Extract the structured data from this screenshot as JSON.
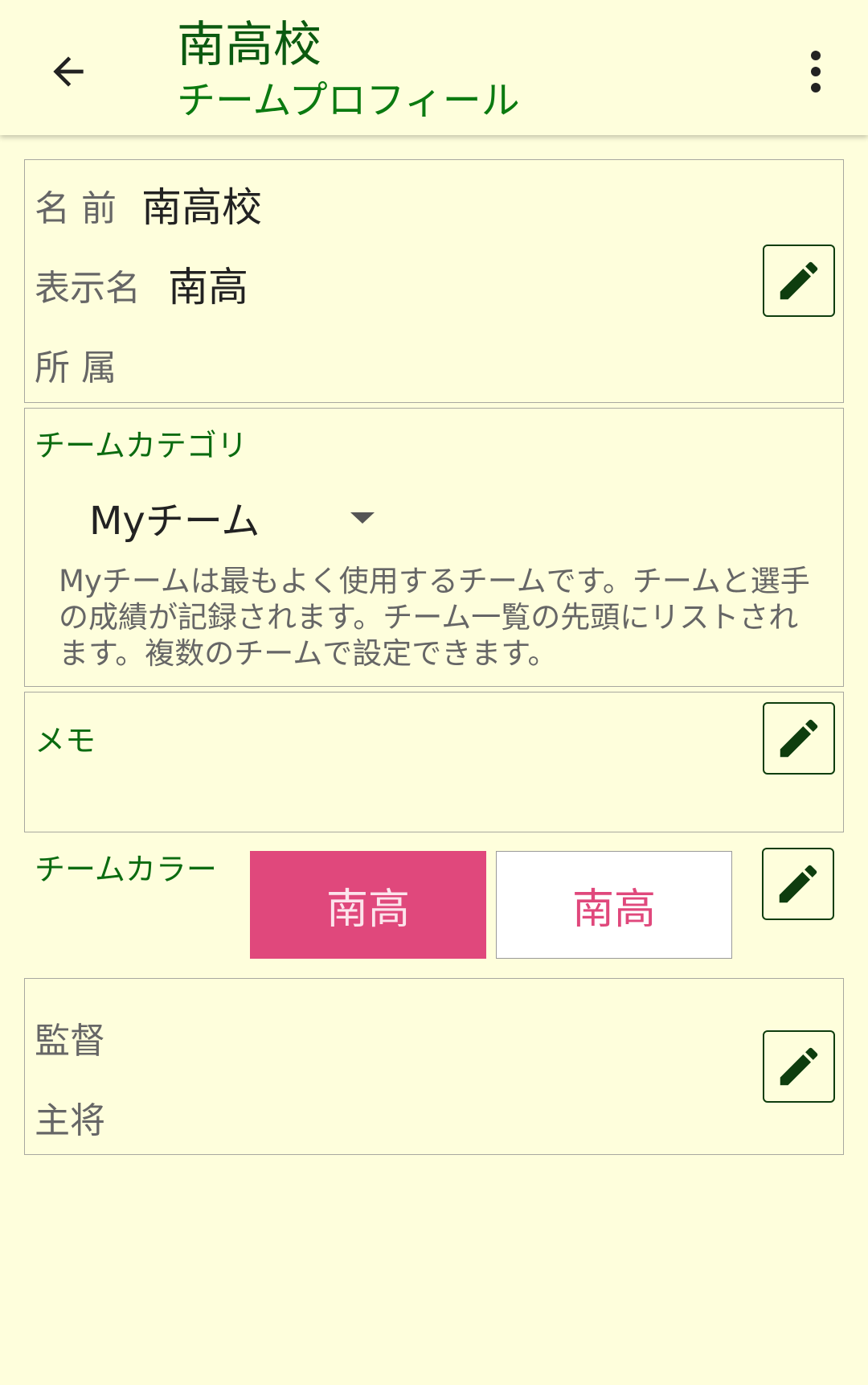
{
  "header": {
    "title": "南高校",
    "subtitle": "チームプロフィール",
    "back_icon": "arrow-left-icon",
    "menu_icon": "more-vert-icon"
  },
  "profile": {
    "name_label": "名 前",
    "name_value": "南高校",
    "display_name_label": "表示名",
    "display_name_value": "南高",
    "affiliation_label": "所 属",
    "affiliation_value": ""
  },
  "category": {
    "label": "チームカテゴリ",
    "selected": "Myチーム",
    "description": "Myチームは最もよく使用するチームです。チームと選手の成績が記録されます。チーム一覧の先頭にリストされます。複数のチームで設定できます。"
  },
  "memo": {
    "label": "メモ",
    "value": ""
  },
  "team_color": {
    "label": "チームカラー",
    "primary_text": "南高",
    "secondary_text": "南高",
    "primary_bg": "#e0487c",
    "primary_fg": "#fce4ec",
    "secondary_bg": "#ffffff",
    "secondary_fg": "#e0487c"
  },
  "staff": {
    "manager_label": "監督",
    "manager_value": "",
    "captain_label": "主将",
    "captain_value": ""
  },
  "colors": {
    "background": "#fefedc",
    "accent_green": "#0b6b10",
    "icon_dark_green": "#0e3d0e"
  }
}
